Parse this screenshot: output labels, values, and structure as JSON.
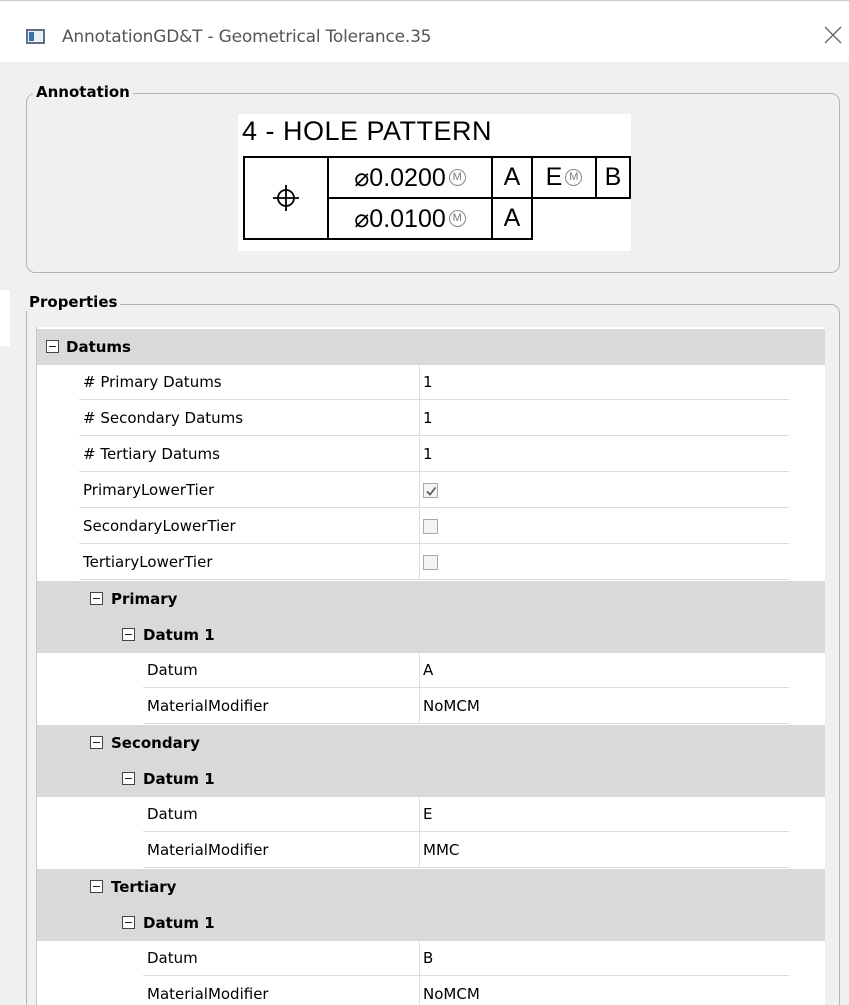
{
  "window": {
    "title": "AnnotationGD&T  - Geometrical Tolerance.35"
  },
  "annotation_group": {
    "label": "Annotation",
    "gdt": {
      "pattern_text": "4 - HOLE PATTERN",
      "symbol": "⌖",
      "row1": {
        "tolerance": "⌀0.0200",
        "modifier": "M",
        "datums": [
          "A",
          "E",
          "B"
        ],
        "datum_modifiers": [
          "",
          "M",
          ""
        ]
      },
      "row2": {
        "tolerance": "⌀0.0100",
        "modifier": "M",
        "datums": [
          "A"
        ]
      }
    }
  },
  "properties_group": {
    "label": "Properties",
    "rows": [
      {
        "kind": "category",
        "label": "Datums",
        "level": 0
      },
      {
        "kind": "prop",
        "name": "# Primary Datums",
        "value": "1",
        "level": 0
      },
      {
        "kind": "prop",
        "name": "# Secondary Datums",
        "value": "1",
        "level": 0
      },
      {
        "kind": "prop",
        "name": "# Tertiary Datums",
        "value": "1",
        "level": 0
      },
      {
        "kind": "check",
        "name": "PrimaryLowerTier",
        "checked": true,
        "level": 0
      },
      {
        "kind": "check",
        "name": "SecondaryLowerTier",
        "checked": false,
        "level": 0
      },
      {
        "kind": "check",
        "name": "TertiaryLowerTier",
        "checked": false,
        "level": 0
      },
      {
        "kind": "category",
        "label": "Primary",
        "level": 1
      },
      {
        "kind": "category",
        "label": "Datum 1",
        "level": 2
      },
      {
        "kind": "prop",
        "name": "Datum",
        "value": "A",
        "level": 2
      },
      {
        "kind": "prop",
        "name": "MaterialModifier",
        "value": "NoMCM",
        "level": 2
      },
      {
        "kind": "category",
        "label": "Secondary",
        "level": 1
      },
      {
        "kind": "category",
        "label": "Datum 1",
        "level": 2
      },
      {
        "kind": "prop",
        "name": "Datum",
        "value": "E",
        "level": 2
      },
      {
        "kind": "prop",
        "name": "MaterialModifier",
        "value": "MMC",
        "level": 2
      },
      {
        "kind": "category",
        "label": "Tertiary",
        "level": 1
      },
      {
        "kind": "category",
        "label": "Datum 1",
        "level": 2
      },
      {
        "kind": "prop",
        "name": "Datum",
        "value": "B",
        "level": 2
      },
      {
        "kind": "prop",
        "name": "MaterialModifier",
        "value": "NoMCM",
        "level": 2
      }
    ]
  },
  "colors": {
    "category_bg": "#d9d9d9",
    "window_bg": "#f0f0f0"
  }
}
